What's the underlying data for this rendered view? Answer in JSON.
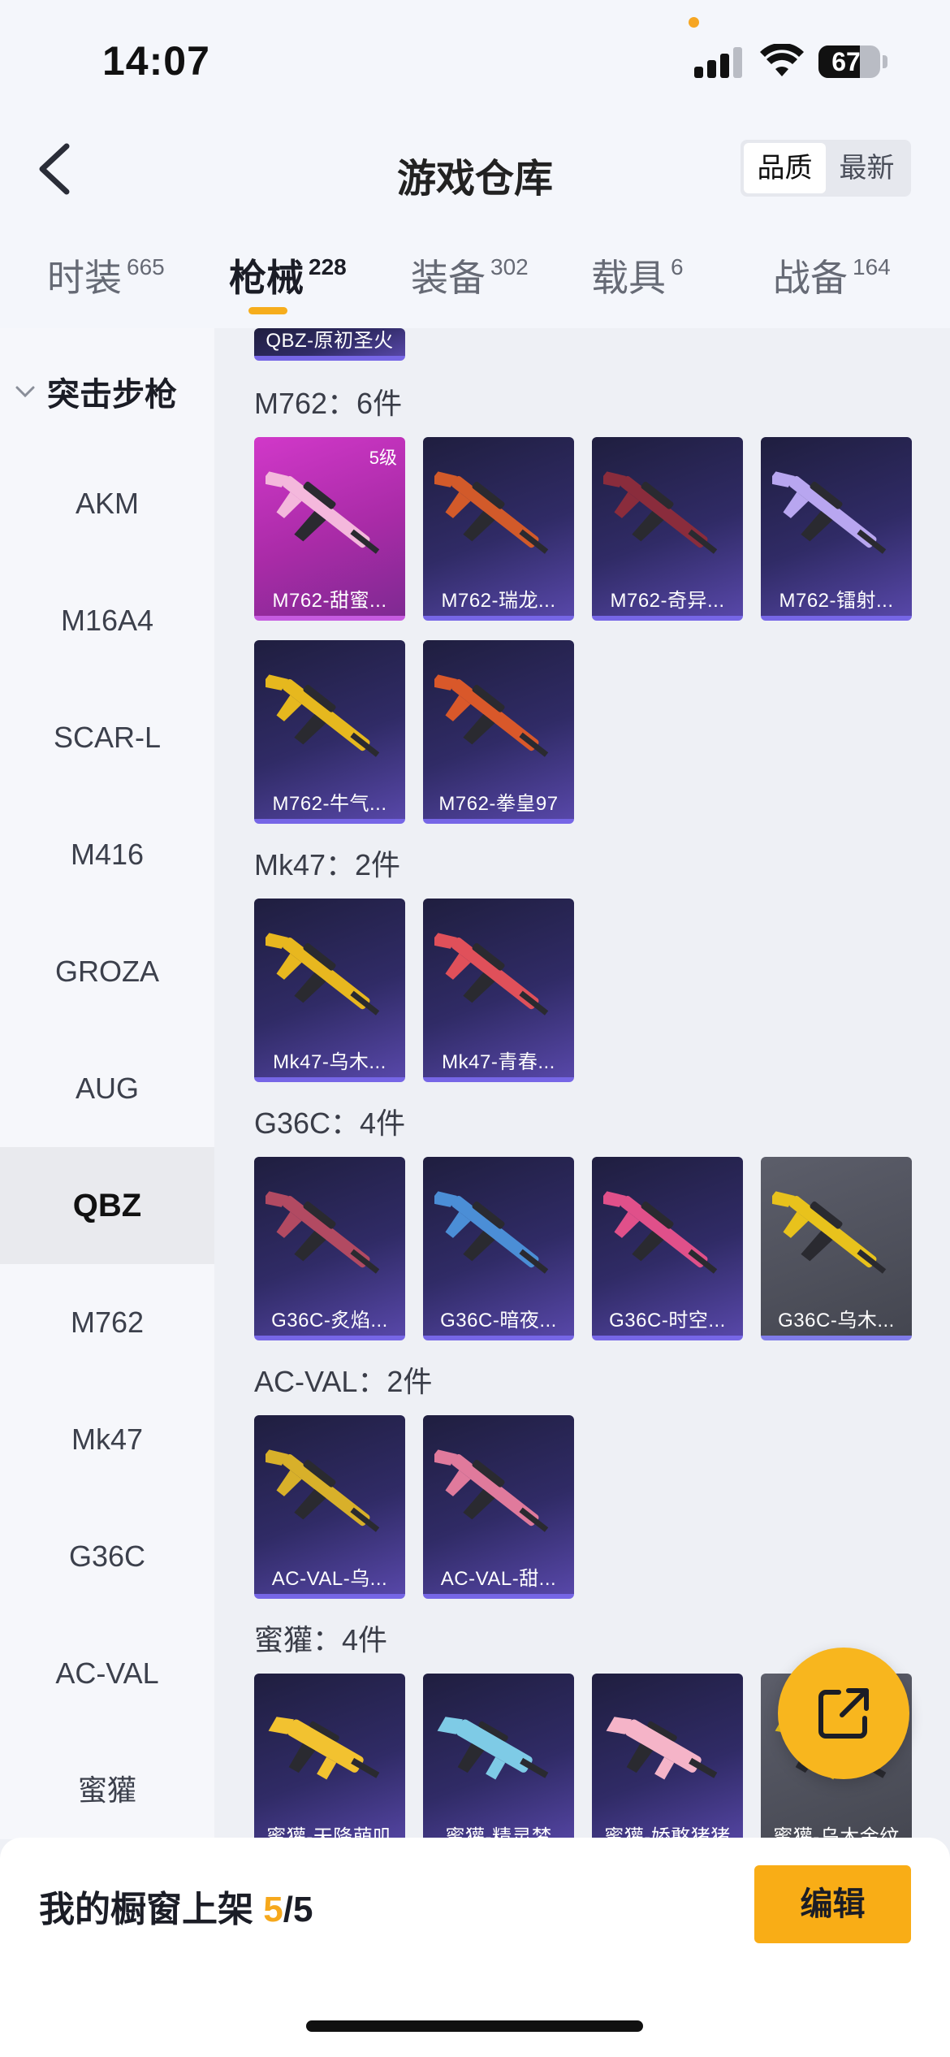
{
  "status_bar": {
    "time": "14:07",
    "battery": "67",
    "battery_level": 0.67
  },
  "header": {
    "title": "游戏仓库",
    "sort_options": [
      "品质",
      "最新"
    ],
    "sort_selected": "品质"
  },
  "tabs": [
    {
      "label": "时装",
      "count": "665"
    },
    {
      "label": "枪械",
      "count": "228",
      "active": true
    },
    {
      "label": "装备",
      "count": "302"
    },
    {
      "label": "载具",
      "count": "6"
    },
    {
      "label": "战备",
      "count": "164"
    }
  ],
  "sidebar": {
    "group": "突击步枪",
    "items": [
      "AKM",
      "M16A4",
      "SCAR-L",
      "M416",
      "GROZA",
      "AUG",
      "QBZ",
      "M762",
      "Mk47",
      "G36C",
      "AC-VAL",
      "蜜獾"
    ],
    "active": "QBZ"
  },
  "content": {
    "top_partial": "QBZ-原初圣火",
    "sections": [
      {
        "title": "M762：6件",
        "items": [
          {
            "name": "M762-甜蜜...",
            "level": "5级",
            "style": "pink",
            "gun_color": "#f4b8dc"
          },
          {
            "name": "M762-瑞龙...",
            "style": "purple",
            "gun_color": "#d25a2a"
          },
          {
            "name": "M762-奇异...",
            "style": "purple",
            "gun_color": "#8a2c3c"
          },
          {
            "name": "M762-镭射...",
            "style": "purple",
            "gun_color": "#b8a6f0"
          },
          {
            "name": "M762-牛气...",
            "style": "purple",
            "gun_color": "#e6b81e"
          },
          {
            "name": "M762-拳皇97",
            "style": "purple",
            "gun_color": "#d9582a"
          }
        ]
      },
      {
        "title": "Mk47：2件",
        "items": [
          {
            "name": "Mk47-乌木...",
            "style": "purple",
            "gun_color": "#e8b71f"
          },
          {
            "name": "Mk47-青春...",
            "style": "purple",
            "gun_color": "#e0505a"
          }
        ]
      },
      {
        "title": "G36C：4件",
        "items": [
          {
            "name": "G36C-炙焰...",
            "style": "purple",
            "gun_color": "#b24a62"
          },
          {
            "name": "G36C-暗夜...",
            "style": "purple",
            "gun_color": "#4b8ed6"
          },
          {
            "name": "G36C-时空...",
            "style": "purple",
            "gun_color": "#e0508a"
          },
          {
            "name": "G36C-乌木...",
            "style": "grey",
            "gun_color": "#e8c21c"
          }
        ]
      },
      {
        "title": "AC-VAL：2件",
        "items": [
          {
            "name": "AC-VAL-乌...",
            "style": "purple",
            "gun_color": "#d8b02a"
          },
          {
            "name": "AC-VAL-甜...",
            "style": "purple",
            "gun_color": "#e07a9c"
          }
        ]
      },
      {
        "title": "蜜獾：4件",
        "items": [
          {
            "name": "蜜獾-天降萌叽",
            "style": "purple",
            "gun_color": "#f2c230"
          },
          {
            "name": "蜜獾-精灵梦",
            "style": "purple",
            "gun_color": "#7ecbe6"
          },
          {
            "name": "蜜獾-娇憨猪猪",
            "style": "purple",
            "gun_color": "#f5b4c8"
          },
          {
            "name": "蜜獾-乌木金纹",
            "style": "grey",
            "gun_color": "#e8c21c"
          }
        ]
      }
    ]
  },
  "bottom_bar": {
    "label": "我的橱窗上架",
    "current": "5",
    "separator": "/",
    "total": "5",
    "edit_label": "编辑"
  },
  "colors": {
    "accent": "#f9ad16",
    "card_purple": "#302b66",
    "card_pink": "#c034b9",
    "card_grey": "#55575f"
  }
}
